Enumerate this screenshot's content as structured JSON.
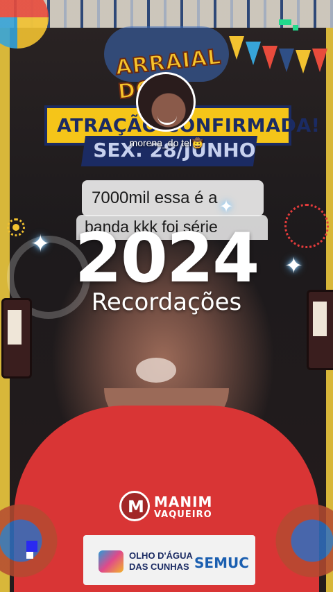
{
  "poster": {
    "event_logo_text": "ARRAIAL DO",
    "banner_confirmed": "ATRAÇÃO CONFIRMADA!",
    "banner_date": "SEX. 28/JUNHO",
    "watermark_brand": "MANIM VAQUEIRO",
    "shirt_brand_initial": "M",
    "shirt_brand_line1": "MANIM",
    "shirt_brand_line2": "VAQUEIRO",
    "footer_city_line1": "OLHO D'ÁGUA",
    "footer_city_line2": "DAS CUNHAS",
    "footer_secretariat": "SEMUC"
  },
  "user": {
    "username": "morena_do tel🤠"
  },
  "caption": {
    "line1": "7000mil essa é a",
    "line2": "banda kkk foi série"
  },
  "memory": {
    "year": "2024",
    "label": "Recordações"
  },
  "colors": {
    "banner_yellow": "#f5c519",
    "banner_navy": "#1b2b63",
    "shirt_red": "#d93535",
    "sparkle_glow": "#5db7ff",
    "indicator_green": "#22d98c"
  },
  "icons": {
    "sparkle": "sparkle-icon",
    "sun": "sun-icon",
    "firework": "firework-icon"
  }
}
